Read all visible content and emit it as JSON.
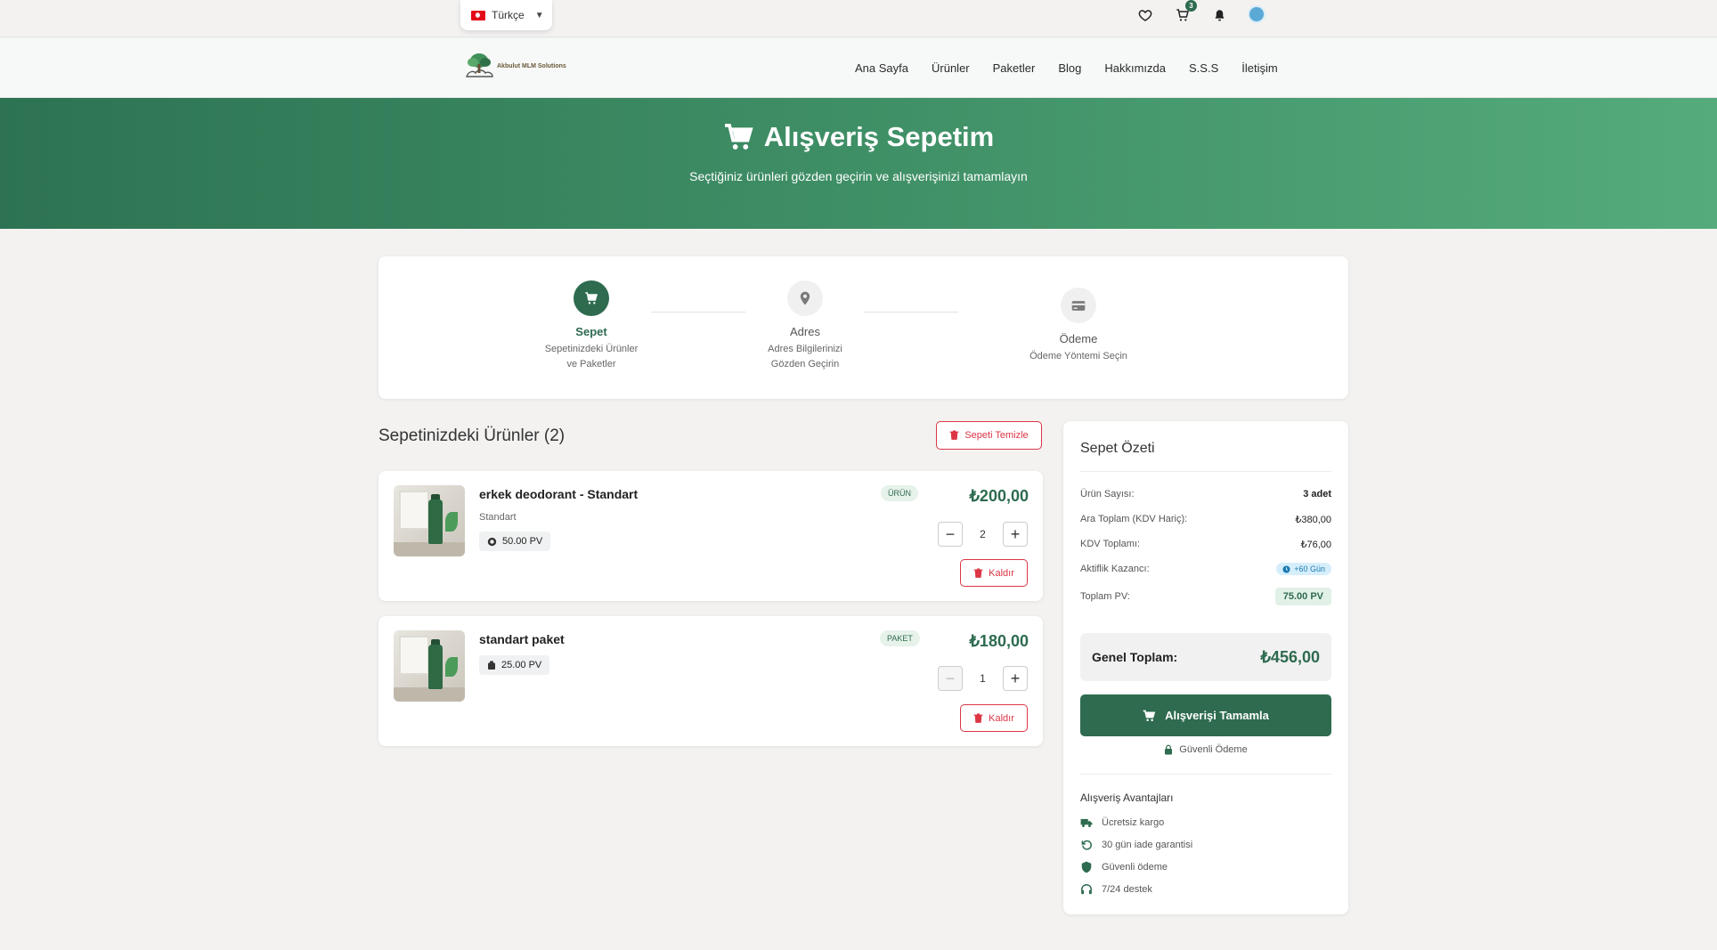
{
  "topbar": {
    "language": "Türkçe",
    "cart_count": "3"
  },
  "nav": {
    "logo_text": "Akbulut MLM Solutions",
    "items": [
      "Ana Sayfa",
      "Ürünler",
      "Paketler",
      "Blog",
      "Hakkımızda",
      "S.S.S",
      "İletişim"
    ]
  },
  "hero": {
    "title": "Alışveriş Sepetim",
    "subtitle": "Seçtiğiniz ürünleri gözden geçirin ve alışverişinizi tamamlayın"
  },
  "steps": [
    {
      "title": "Sepet",
      "sub1": "Sepetinizdeki Ürünler",
      "sub2": "ve Paketler"
    },
    {
      "title": "Adres",
      "sub1": "Adres Bilgilerinizi",
      "sub2": "Gözden Geçirin"
    },
    {
      "title": "Ödeme",
      "sub1": "Ödeme Yöntemi Seçin",
      "sub2": ""
    }
  ],
  "cart": {
    "title": "Sepetinizdeki Ürünler (2)",
    "clear_label": "Sepeti Temizle",
    "remove_label": "Kaldır",
    "items": [
      {
        "name": "erkek deodorant - Standart",
        "variant": "Standart",
        "pv": "50.00 PV",
        "type": "ÜRÜN",
        "price": "₺200,00",
        "qty": "2"
      },
      {
        "name": "standart paket",
        "variant": "",
        "pv": "25.00 PV",
        "type": "PAKET",
        "price": "₺180,00",
        "qty": "1"
      }
    ]
  },
  "summary": {
    "title": "Sepet Özeti",
    "rows": [
      {
        "label": "Ürün Sayısı:",
        "value": "3 adet"
      },
      {
        "label": "Ara Toplam (KDV Hariç):",
        "value": "₺380,00"
      },
      {
        "label": "KDV Toplamı:",
        "value": "₺76,00"
      },
      {
        "label": "Aktiflik Kazancı:",
        "value": "+60 Gün"
      },
      {
        "label": "Toplam PV:",
        "value": "75.00 PV"
      }
    ],
    "grand_label": "Genel Toplam:",
    "grand_value": "₺456,00",
    "checkout_label": "Alışverişi Tamamla",
    "secure_label": "Güvenli Ödeme",
    "advantages_title": "Alışveriş Avantajları",
    "advantages": [
      "Ücretsiz kargo",
      "30 gün iade garantisi",
      "Güvenli ödeme",
      "7/24 destek"
    ]
  },
  "colors": {
    "primary": "#2e6b4f",
    "danger": "#dc3545",
    "info": "#1b7bb3"
  }
}
